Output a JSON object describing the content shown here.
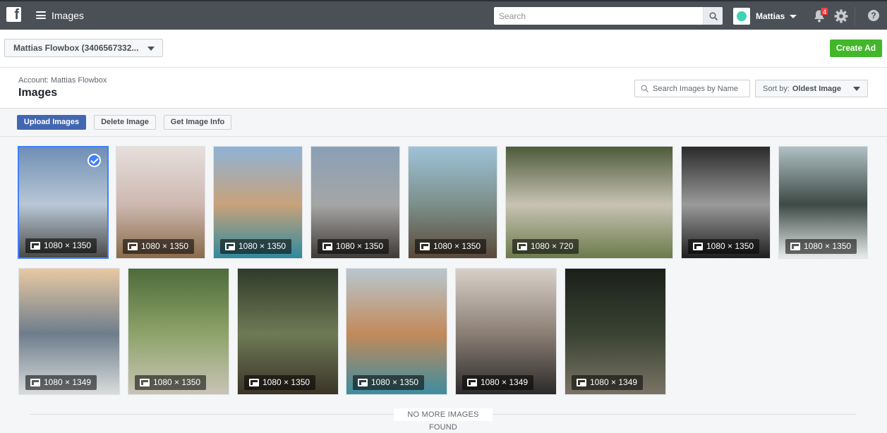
{
  "topbar": {
    "logo": "f",
    "app_title": "Images",
    "search_placeholder": "Search",
    "user_name": "Mattias",
    "notification_count": "4"
  },
  "account_bar": {
    "account_name": "Mattias Flowbox (3406567332...",
    "create_ad_label": "Create Ad"
  },
  "header": {
    "account_label": "Account: Mattias Flowbox",
    "title": "Images",
    "search_placeholder": "Search Images by Name",
    "sort_prefix": "Sort by:",
    "sort_value": "Oldest Image"
  },
  "toolbar": {
    "upload_label": "Upload Images",
    "delete_label": "Delete Image",
    "info_label": "Get Image Info"
  },
  "images": [
    {
      "dimensions": "1080 × 1350",
      "selected": true,
      "colors": [
        "#6f8fb5",
        "#b9c7d6",
        "#4a4a48"
      ]
    },
    {
      "dimensions": "1080 × 1350",
      "selected": false,
      "colors": [
        "#e6dfdc",
        "#cdb8b0",
        "#8a6b4a"
      ]
    },
    {
      "dimensions": "1080 × 1350",
      "selected": false,
      "colors": [
        "#8fb3d6",
        "#c8a27a",
        "#2e8a9e"
      ]
    },
    {
      "dimensions": "1080 × 1350",
      "selected": false,
      "colors": [
        "#8aa0b6",
        "#a5a6a6",
        "#3f3a36"
      ]
    },
    {
      "dimensions": "1080 × 1350",
      "selected": false,
      "colors": [
        "#9ec3d8",
        "#7c8f8a",
        "#5a4838"
      ]
    },
    {
      "dimensions": "1080 × 720",
      "selected": false,
      "colors": [
        "#4e5a3a",
        "#c7c3b4",
        "#6b7a4b"
      ]
    },
    {
      "dimensions": "1080 × 1350",
      "selected": false,
      "colors": [
        "#2a2a2a",
        "#9a9a9a",
        "#1f1f1f"
      ]
    },
    {
      "dimensions": "1080 × 1350",
      "selected": false,
      "colors": [
        "#b0c0c4",
        "#3d4a45",
        "#e8ecec"
      ]
    },
    {
      "dimensions": "1080 × 1349",
      "selected": false,
      "colors": [
        "#e8c9a2",
        "#6e7d8c",
        "#d9dcdc"
      ]
    },
    {
      "dimensions": "1080 × 1350",
      "selected": false,
      "colors": [
        "#4e6b3a",
        "#8ea36a",
        "#c9c4b6"
      ]
    },
    {
      "dimensions": "1080 × 1350",
      "selected": false,
      "colors": [
        "#2f3a2a",
        "#6e7a55",
        "#3b3428"
      ]
    },
    {
      "dimensions": "1080 × 1350",
      "selected": false,
      "colors": [
        "#b8c7cf",
        "#c28a5a",
        "#3d8da0"
      ]
    },
    {
      "dimensions": "1080 × 1349",
      "selected": false,
      "colors": [
        "#d8d0c8",
        "#8a7e74",
        "#2b2a2a"
      ]
    },
    {
      "dimensions": "1080 × 1349",
      "selected": false,
      "colors": [
        "#1b1f1a",
        "#3a4332",
        "#7a7466"
      ]
    }
  ],
  "footer": {
    "end_text": "NO MORE IMAGES FOUND"
  }
}
